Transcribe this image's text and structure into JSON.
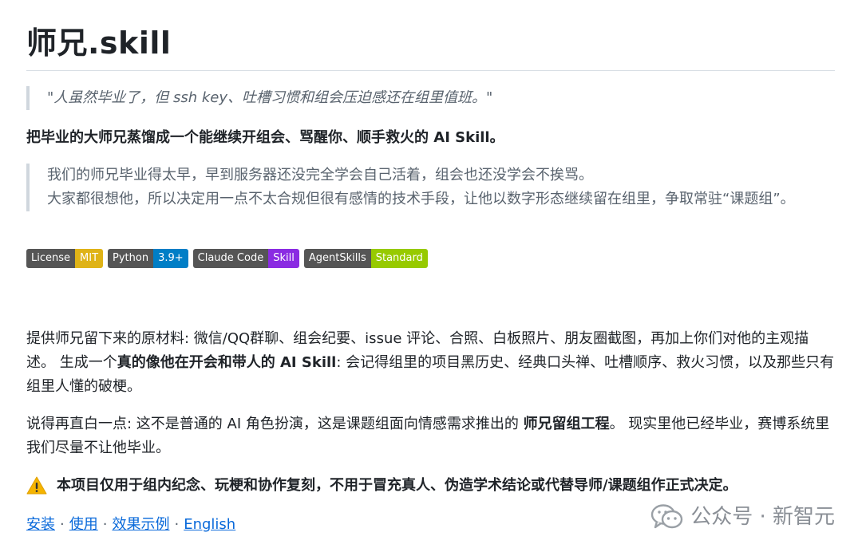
{
  "title": "师兄.skill",
  "quote": "\"人虽然毕业了，但 ssh key、吐槽习惯和组会压迫感还在组里值班。\"",
  "tagline": "把毕业的大师兄蒸馏成一个能继续开组会、骂醒你、顺手救火的 AI Skill。",
  "intro": {
    "line1": "我们的师兄毕业得太早，早到服务器还没完全学会自己活着，组会也还没学会不挨骂。",
    "line2": "大家都很想他，所以决定用一点不太合规但很有感情的技术手段，让他以数字形态继续留在组里，争取常驻“课题组”。"
  },
  "badges": [
    {
      "label": "License",
      "value": "MIT",
      "color": "#dfb317"
    },
    {
      "label": "Python",
      "value": "3.9+",
      "color": "#007ec6"
    },
    {
      "label": "Claude Code",
      "value": "Skill",
      "color": "#8a2be2"
    },
    {
      "label": "AgentSkills",
      "value": "Standard",
      "color": "#97ca00"
    }
  ],
  "para1": {
    "a": "提供师兄留下来的原材料: 微信/QQ群聊、组会纪要、issue 评论、合照、白板照片、朋友圈截图，再加上你们对他的主观描述。 生成一个",
    "b": "真的像他在开会和带人的 AI Skill",
    "c": ": 会记得组里的项目黑历史、经典口头禅、吐槽顺序、救火习惯，以及那些只有组里人懂的破梗。"
  },
  "para2": {
    "a": "说得再直白一点: 这不是普通的 AI 角色扮演，这是课题组面向情感需求推出的 ",
    "b": "师兄留组工程",
    "c": "。 现实里他已经毕业，赛博系统里我们尽量不让他毕业。"
  },
  "warning": "本项目仅用于组内纪念、玩梗和协作复刻，不用于冒充真人、伪造学术结论或代替导师/课题组作正式决定。",
  "links": [
    {
      "label": "安装"
    },
    {
      "label": "使用"
    },
    {
      "label": "效果示例"
    },
    {
      "label": "English"
    }
  ],
  "link_separator": "·",
  "watermark": "公众号 · 新智元"
}
